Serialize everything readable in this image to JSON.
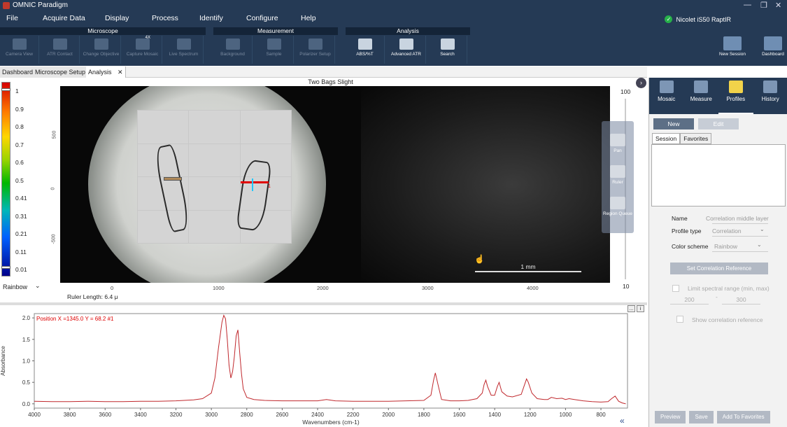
{
  "app": {
    "title": "OMNIC Paradigm",
    "instrument": "Nicolet iS50 RaptIR"
  },
  "menu": [
    "File",
    "Acquire Data",
    "Display",
    "Process",
    "Identify",
    "Configure",
    "Help"
  ],
  "window_controls": {
    "min": "—",
    "max": "❐",
    "close": "✕"
  },
  "ribbon": {
    "groups": [
      {
        "title": "Microscope",
        "buttons": [
          {
            "label": "Camera View",
            "on": false
          },
          {
            "label": "ATR Contact",
            "on": false
          },
          {
            "label": "Change Objective",
            "on": false
          },
          {
            "label": "Capture Mosaic",
            "on": false,
            "badge": "4X"
          },
          {
            "label": "Live Spectrum",
            "on": false
          }
        ]
      },
      {
        "title": "Measurement",
        "buttons": [
          {
            "label": "Background",
            "on": false
          },
          {
            "label": "Sample",
            "on": false
          },
          {
            "label": "Polarizer Setup",
            "on": false
          }
        ]
      },
      {
        "title": "Analysis",
        "buttons": [
          {
            "label": "ABS/%T",
            "on": true
          },
          {
            "label": "Advanced ATR",
            "on": true
          },
          {
            "label": "Search",
            "on": true
          }
        ]
      }
    ],
    "right_buttons": [
      "New Session",
      "Dashboard"
    ]
  },
  "tabs": [
    {
      "label": "Dashboard",
      "active": false
    },
    {
      "label": "Microscope Setup",
      "active": false
    },
    {
      "label": "Analysis",
      "active": true,
      "close": "✕"
    }
  ],
  "image": {
    "title": "Two Bags Slight",
    "colorbar_ticks": [
      "1",
      "0.9",
      "0.8",
      "0.7",
      "0.6",
      "0.5",
      "0.41",
      "0.31",
      "0.21",
      "0.11",
      "0.01"
    ],
    "color_scheme": "Rainbow",
    "x_ticks": [
      "0",
      "1000",
      "2000",
      "3000",
      "4000"
    ],
    "y_ticks": [
      "500",
      "0",
      "-500"
    ],
    "scale_bar": "1 mm",
    "ruler_length": "Ruler Length: 6.4 μ",
    "zoom_max": "100",
    "zoom_min": "10",
    "marker_label": "1",
    "tools": [
      "Pan",
      "Ruler",
      "Region Queue"
    ]
  },
  "chart_data": {
    "type": "line",
    "title": "",
    "annotation": "Position X =1345.0 Y = 68.2 #1",
    "xlabel": "Wavenumbers (cm-1)",
    "ylabel": "Absorbance",
    "xlim": [
      4000,
      650
    ],
    "ylim": [
      -0.1,
      2.1
    ],
    "x_ticks": [
      4000,
      3800,
      3600,
      3400,
      3200,
      3000,
      2800,
      2600,
      2400,
      2200,
      2000,
      1800,
      1600,
      1400,
      1200,
      1000,
      800
    ],
    "y_ticks": [
      "0.0",
      "0.5",
      "1.0",
      "1.5",
      "2.0"
    ],
    "series": [
      {
        "color": "#c0282d",
        "x": [
          4000,
          3900,
          3800,
          3700,
          3600,
          3500,
          3400,
          3300,
          3200,
          3100,
          3050,
          3000,
          2980,
          2960,
          2940,
          2930,
          2920,
          2910,
          2900,
          2890,
          2880,
          2870,
          2860,
          2850,
          2840,
          2830,
          2820,
          2800,
          2760,
          2700,
          2600,
          2500,
          2400,
          2350,
          2300,
          2200,
          2100,
          2000,
          1900,
          1800,
          1760,
          1745,
          1735,
          1720,
          1700,
          1650,
          1600,
          1550,
          1500,
          1470,
          1460,
          1450,
          1440,
          1420,
          1400,
          1385,
          1375,
          1360,
          1330,
          1300,
          1250,
          1235,
          1220,
          1210,
          1190,
          1160,
          1120,
          1100,
          1080,
          1050,
          1020,
          1000,
          980,
          950,
          900,
          850,
          800,
          760,
          740,
          720,
          700,
          680,
          660
        ],
        "y": [
          0.06,
          0.05,
          0.05,
          0.06,
          0.05,
          0.05,
          0.06,
          0.06,
          0.07,
          0.09,
          0.12,
          0.25,
          0.6,
          1.3,
          1.9,
          2.06,
          1.98,
          1.5,
          0.9,
          0.6,
          0.75,
          1.1,
          1.58,
          1.72,
          1.2,
          0.7,
          0.35,
          0.15,
          0.1,
          0.08,
          0.07,
          0.07,
          0.07,
          0.1,
          0.07,
          0.06,
          0.06,
          0.06,
          0.07,
          0.08,
          0.2,
          0.55,
          0.72,
          0.45,
          0.1,
          0.07,
          0.07,
          0.08,
          0.12,
          0.25,
          0.45,
          0.55,
          0.4,
          0.2,
          0.2,
          0.4,
          0.5,
          0.28,
          0.18,
          0.16,
          0.22,
          0.4,
          0.58,
          0.5,
          0.25,
          0.12,
          0.1,
          0.1,
          0.15,
          0.12,
          0.13,
          0.1,
          0.12,
          0.1,
          0.07,
          0.05,
          0.04,
          0.05,
          0.12,
          0.18,
          0.06,
          0.02,
          0.0
        ]
      }
    ]
  },
  "spec_buttons": [
    "...",
    "i"
  ],
  "collapse_icon": "«",
  "right_panel": {
    "tabs": [
      {
        "label": "Mosaic",
        "on": false
      },
      {
        "label": "Measure",
        "on": false
      },
      {
        "label": "Profiles",
        "on": true
      },
      {
        "label": "History",
        "on": false
      }
    ],
    "new_label": "New",
    "edit_label": "Edit",
    "subtabs": [
      {
        "label": "Session",
        "on": true
      },
      {
        "label": "Favorites",
        "on": false
      }
    ],
    "name_label": "Name",
    "name_value": "Correlation middle layer",
    "profile_type_label": "Profile type",
    "profile_type_value": "Correlation",
    "color_scheme_label": "Color scheme",
    "color_scheme_value": "Rainbow",
    "set_ref": "Set Correlation Reference",
    "limit_label": "Limit spectral range (min, max)",
    "limit_min": "200",
    "limit_max": "300",
    "limit_dash": "-",
    "show_ref": "Show correlation reference",
    "bottom": [
      "Preview",
      "Save",
      "Add To Favorites"
    ]
  }
}
